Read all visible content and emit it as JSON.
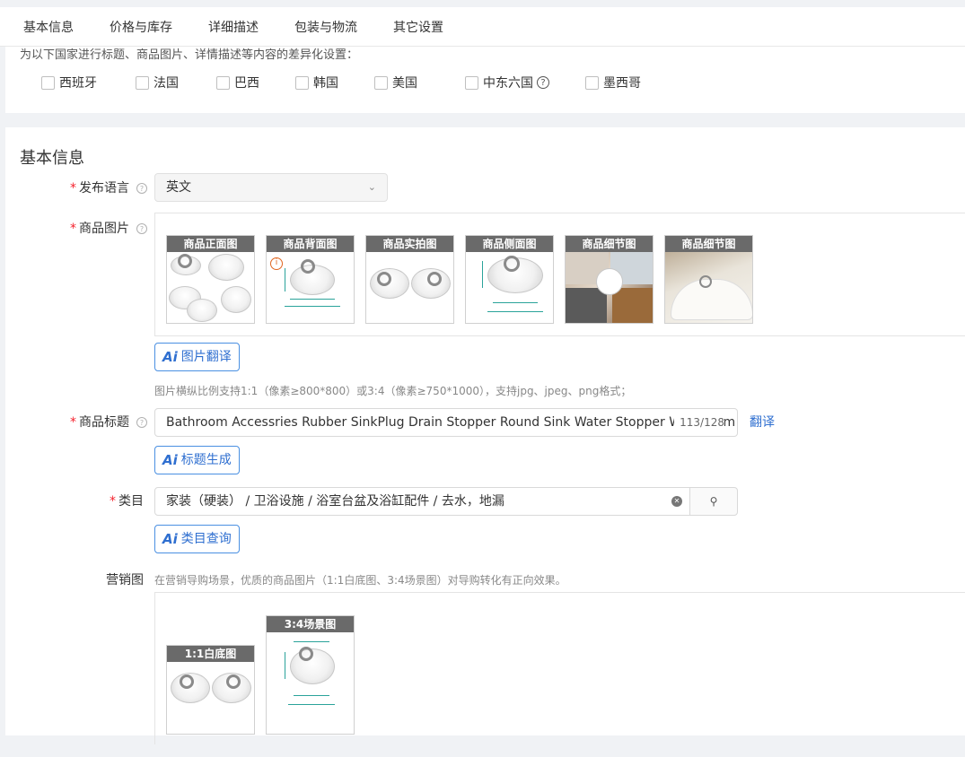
{
  "tabs": [
    "基本信息",
    "价格与库存",
    "详细描述",
    "包装与物流",
    "其它设置"
  ],
  "country_section": {
    "description": "为以下国家进行标题、商品图片、详情描述等内容的差异化设置：",
    "countries": [
      "西班牙",
      "法国",
      "巴西",
      "韩国",
      "美国",
      "中东六国",
      "墨西哥"
    ]
  },
  "basic_info": {
    "title": "基本信息",
    "language": {
      "label": "发布语言",
      "value": "英文"
    },
    "product_images": {
      "label": "商品图片",
      "items": [
        "商品正面图",
        "商品背面图",
        "商品实拍图",
        "商品侧面图",
        "商品细节图",
        "商品细节图"
      ],
      "translate_button": "图片翻译",
      "hint": "图片横纵比例支持1:1（像素≥800*800）或3:4（像素≥750*1000），支持jpg、jpeg、png格式；"
    },
    "product_title": {
      "label": "商品标题",
      "value": "Bathroom Accessries Rubber SinkPlug Drain Stopper Round Sink Water Stopper Washroom",
      "count": "113/128",
      "translate_link": "翻译",
      "generate_button": "标题生成"
    },
    "category": {
      "label": "类目",
      "value": "家装（硬装） / 卫浴设施 / 浴室台盆及浴缸配件 / 去水，地漏",
      "query_button": "类目查询"
    },
    "marketing_images": {
      "label": "营销图",
      "hint": "在营销导购场景，优质的商品图片（1:1白底图、3:4场景图）对导购转化有正向效果。",
      "items": [
        "1:1白底图",
        "3:4场景图"
      ]
    }
  },
  "ai_label": "Ai",
  "colors": {
    "accent": "#2f6fd0",
    "required": "#f5222d"
  }
}
